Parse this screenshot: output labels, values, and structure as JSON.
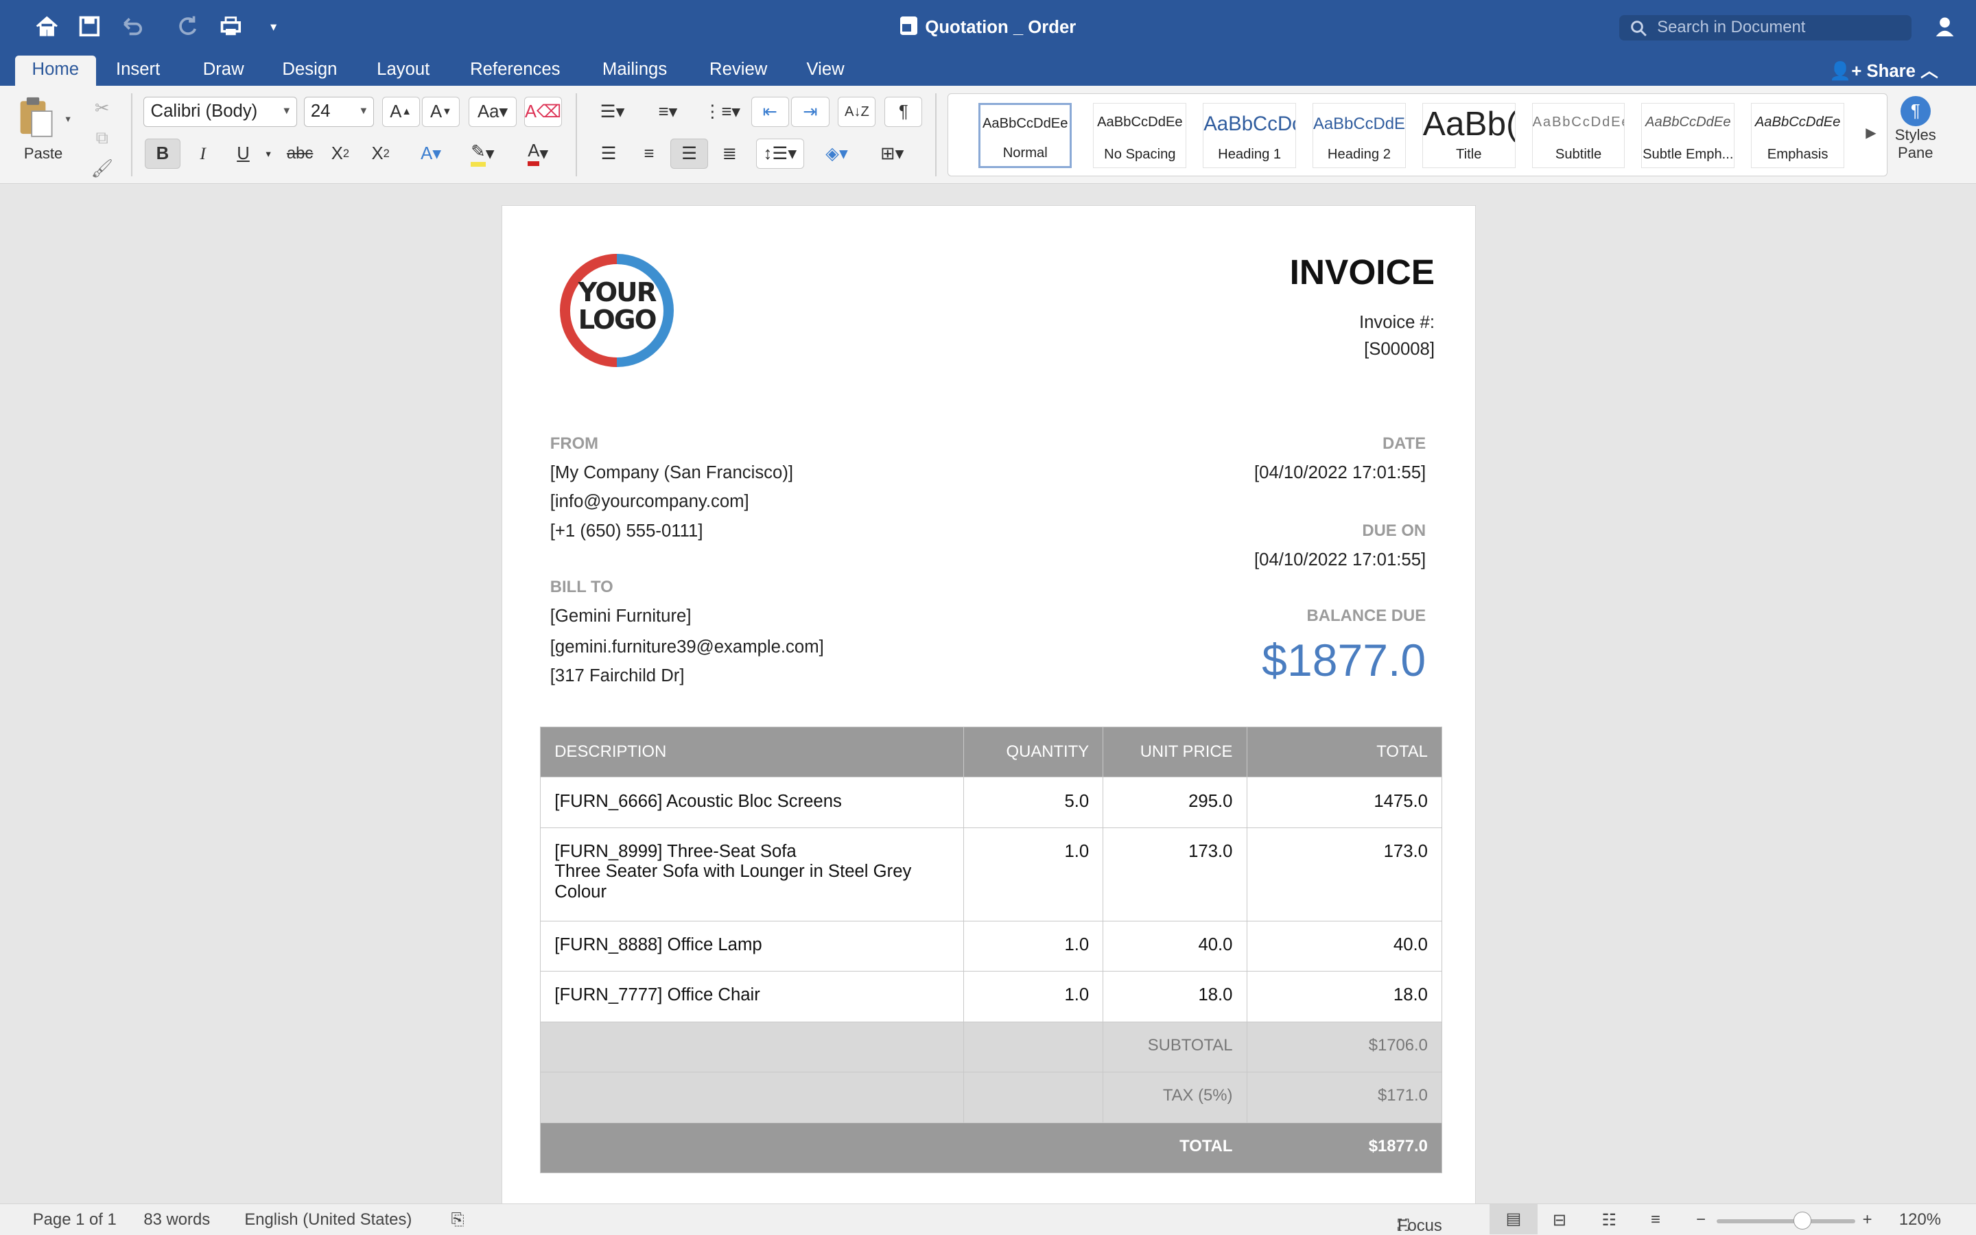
{
  "window": {
    "title": "Quotation _ Order",
    "search_placeholder": "Search in Document"
  },
  "tabs": [
    "Home",
    "Insert",
    "Draw",
    "Design",
    "Layout",
    "References",
    "Mailings",
    "Review",
    "View"
  ],
  "share_label": "Share",
  "ribbon": {
    "paste_label": "Paste",
    "font_name": "Calibri (Body)",
    "font_size": "24",
    "styles": [
      {
        "sample": "AaBbCcDdEe",
        "label": "Normal"
      },
      {
        "sample": "AaBbCcDdEe",
        "label": "No Spacing"
      },
      {
        "sample": "AaBbCcDc",
        "label": "Heading 1"
      },
      {
        "sample": "AaBbCcDdEe",
        "label": "Heading 2"
      },
      {
        "sample": "AaBb(",
        "label": "Title"
      },
      {
        "sample": "AaBbCcDdEe",
        "label": "Subtitle"
      },
      {
        "sample": "AaBbCcDdEe",
        "label": "Subtle Emph..."
      },
      {
        "sample": "AaBbCcDdEe",
        "label": "Emphasis"
      }
    ],
    "styles_pane_label": "Styles Pane"
  },
  "invoice": {
    "logo_text": "YOUR LOGO",
    "title": "INVOICE",
    "invoice_no_label": "Invoice #:",
    "invoice_no": "[S00008]",
    "from_label": "FROM",
    "from": [
      "[My Company (San Francisco)]",
      "[info@yourcompany.com]",
      "[+1 (650) 555-0111]"
    ],
    "bill_to_label": "BILL TO",
    "bill_to": [
      "[Gemini Furniture]",
      "[gemini.furniture39@example.com]",
      "[317 Fairchild Dr]"
    ],
    "date_label": "DATE",
    "date": "[04/10/2022 17:01:55]",
    "due_label": "DUE ON",
    "due": "[04/10/2022 17:01:55]",
    "balance_label": "BALANCE DUE",
    "balance": "$1877.0",
    "table_headers": [
      "DESCRIPTION",
      "QUANTITY",
      "UNIT PRICE",
      "TOTAL"
    ],
    "rows": [
      {
        "desc": "[FURN_6666] Acoustic Bloc Screens",
        "desc2": "",
        "desc3": "",
        "qty": "5.0",
        "price": "295.0",
        "total": "1475.0"
      },
      {
        "desc": "[FURN_8999] Three-Seat Sofa",
        "desc2": "Three Seater Sofa with Lounger in Steel Grey",
        "desc3": "Colour",
        "qty": "1.0",
        "price": "173.0",
        "total": "173.0"
      },
      {
        "desc": "[FURN_8888] Office Lamp",
        "desc2": "",
        "desc3": "",
        "qty": "1.0",
        "price": "40.0",
        "total": "40.0"
      },
      {
        "desc": "[FURN_7777] Office Chair",
        "desc2": "",
        "desc3": "",
        "qty": "1.0",
        "price": "18.0",
        "total": "18.0"
      }
    ],
    "subtotal_label": "SUBTOTAL",
    "subtotal": "$1706.0",
    "tax_label": "TAX (5%)",
    "tax": "$171.0",
    "total_label": "TOTAL",
    "total": "$1877.0"
  },
  "status": {
    "page": "Page 1 of 1",
    "words": "83 words",
    "language": "English (United States)",
    "focus": "Focus",
    "zoom": "120%",
    "zoom_level": 0.62
  }
}
